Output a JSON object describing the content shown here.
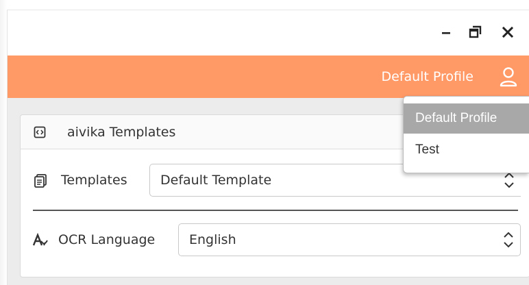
{
  "titlebar": {
    "minimize_icon": "minimize-icon",
    "maximize_icon": "maximize-icon",
    "close_icon": "close-icon"
  },
  "header": {
    "profile_label": "Default Profile",
    "user_icon": "user-icon",
    "background_color": "#ff9966"
  },
  "card": {
    "title": "aivika Templates",
    "icon": "template-file-icon"
  },
  "templates_row": {
    "label": "Templates",
    "icon": "documents-icon",
    "selected_value": "Default Template"
  },
  "ocr_row": {
    "label": "OCR Language",
    "icon": "text-font-icon",
    "selected_value": "English"
  },
  "profile_dropdown": {
    "items": [
      {
        "label": "Default Profile",
        "selected": true
      },
      {
        "label": "Test",
        "selected": false
      }
    ],
    "selected_color": "#a8a8a8"
  }
}
